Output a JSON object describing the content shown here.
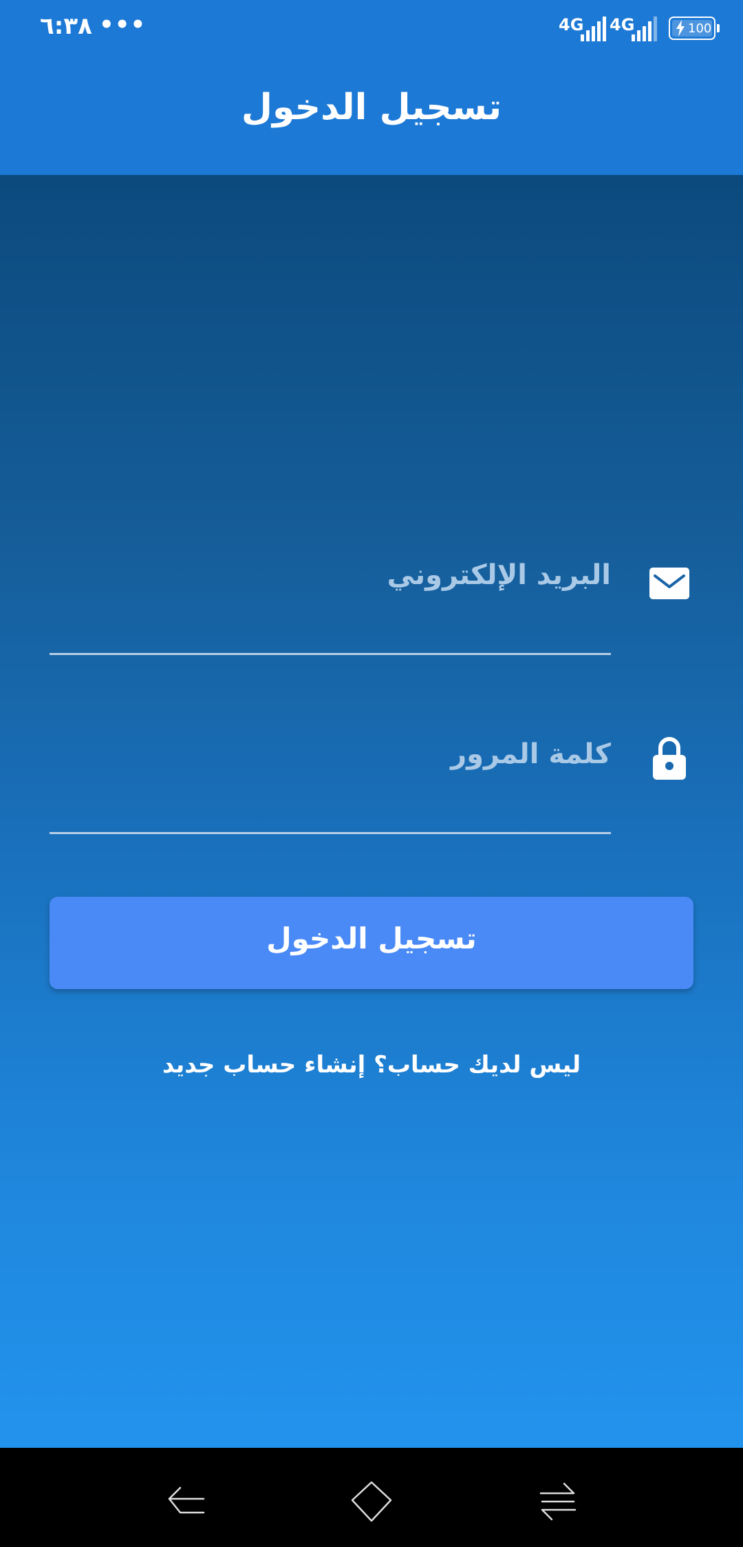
{
  "status_bar": {
    "time": "٦:٣٨",
    "dots": "•••",
    "network_1": "4G",
    "network_2": "4G",
    "battery_level": "100",
    "icons": [
      "signal-icon",
      "signal-icon",
      "battery-charging-icon"
    ]
  },
  "app_bar": {
    "title": "تسجيل الدخول"
  },
  "form": {
    "email": {
      "placeholder": "البريد الإلكتروني",
      "icon": "envelope-icon"
    },
    "password": {
      "placeholder": "كلمة المرور",
      "icon": "lock-icon"
    },
    "login_button_label": "تسجيل الدخول",
    "signup_link": "ليس لديك حساب؟ إنشاء حساب جديد"
  },
  "nav_bar": {
    "buttons": [
      "back-icon",
      "home-icon",
      "recents-icon"
    ]
  },
  "colors": {
    "app_bar": "#1c79d6",
    "gradient_top": "#0c4a7d",
    "gradient_bottom": "#2293ed",
    "button": "#4a8af6",
    "text": "#ffffff",
    "placeholder": "#a9c9e6"
  }
}
